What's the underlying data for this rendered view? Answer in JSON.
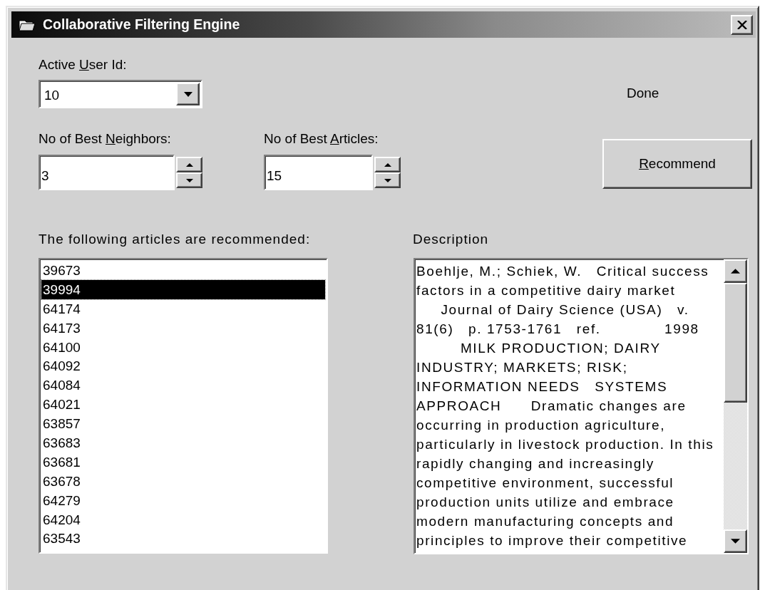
{
  "window": {
    "title": "Collaborative Filtering Engine"
  },
  "active_user": {
    "label": {
      "pre": "Active ",
      "key": "U",
      "post": "ser Id:"
    },
    "value": "10"
  },
  "status": "Done",
  "neighbors": {
    "label": {
      "pre": "No of Best ",
      "key": "N",
      "post": "eighbors:"
    },
    "value": "3"
  },
  "articles": {
    "label": {
      "pre": "No of Best ",
      "key": "A",
      "post": "rticles:"
    },
    "value": "15"
  },
  "recommend_button": {
    "key": "R",
    "post": "ecommend"
  },
  "recommended": {
    "label": "The following articles are recommended:",
    "items": [
      {
        "text": "39673",
        "selected": false
      },
      {
        "text": "39994",
        "selected": true
      },
      {
        "text": "64174",
        "selected": false
      },
      {
        "text": "64173",
        "selected": false
      },
      {
        "text": "64100",
        "selected": false
      },
      {
        "text": "64092",
        "selected": false
      },
      {
        "text": "64084",
        "selected": false
      },
      {
        "text": "64021",
        "selected": false
      },
      {
        "text": "63857",
        "selected": false
      },
      {
        "text": "63683",
        "selected": false
      },
      {
        "text": "63681",
        "selected": false
      },
      {
        "text": "63678",
        "selected": false
      },
      {
        "text": "64279",
        "selected": false
      },
      {
        "text": "64204",
        "selected": false
      },
      {
        "text": "63543",
        "selected": false
      }
    ]
  },
  "description": {
    "label": "Description",
    "lines": [
      "Boehlje, M.; Schiek, W.   Critical success",
      "factors in a competitive dairy market",
      "     Journal of Dairy Science (USA)   v.",
      "81(6)   p. 1753-1761   ref.             1998",
      "         MILK PRODUCTION; DAIRY",
      "INDUSTRY; MARKETS; RISK;",
      "INFORMATION NEEDS   SYSTEMS",
      "APPROACH      Dramatic changes are",
      "occurring in production agriculture,",
      "particularly in livestock production. In this",
      "rapidly changing and increasingly",
      "competitive environment, successful",
      "production units utilize and embrace",
      "modern manufacturing concepts and",
      "principles to improve their competitive"
    ]
  }
}
